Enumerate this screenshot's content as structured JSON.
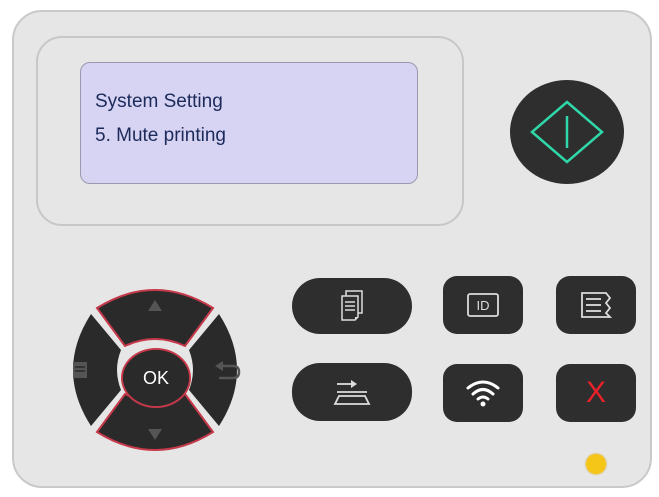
{
  "display": {
    "line1": "System Setting",
    "line2": "5. Mute printing"
  },
  "buttons": {
    "ok_label": "OK",
    "cancel_glyph": "X"
  },
  "icons": {
    "start": "start-icon",
    "up": "arrow-up-icon",
    "down": "arrow-down-icon",
    "menu": "menu-icon",
    "back": "back-icon",
    "copy": "copy-icon",
    "scan": "scan-icon",
    "id_copy": "id-card-icon",
    "wifi": "wifi-icon",
    "info_list": "info-list-icon",
    "cancel": "cancel-icon"
  },
  "colors": {
    "panel": "#e6e6e6",
    "lcd_background": "#d6d3f3",
    "lcd_text": "#1c2a5a",
    "button": "#2e2e2e",
    "start_accent": "#2fd8a8",
    "cancel_accent": "#e8212b",
    "dpad_outline": "#c6394a",
    "status_led": "#f5c518"
  }
}
